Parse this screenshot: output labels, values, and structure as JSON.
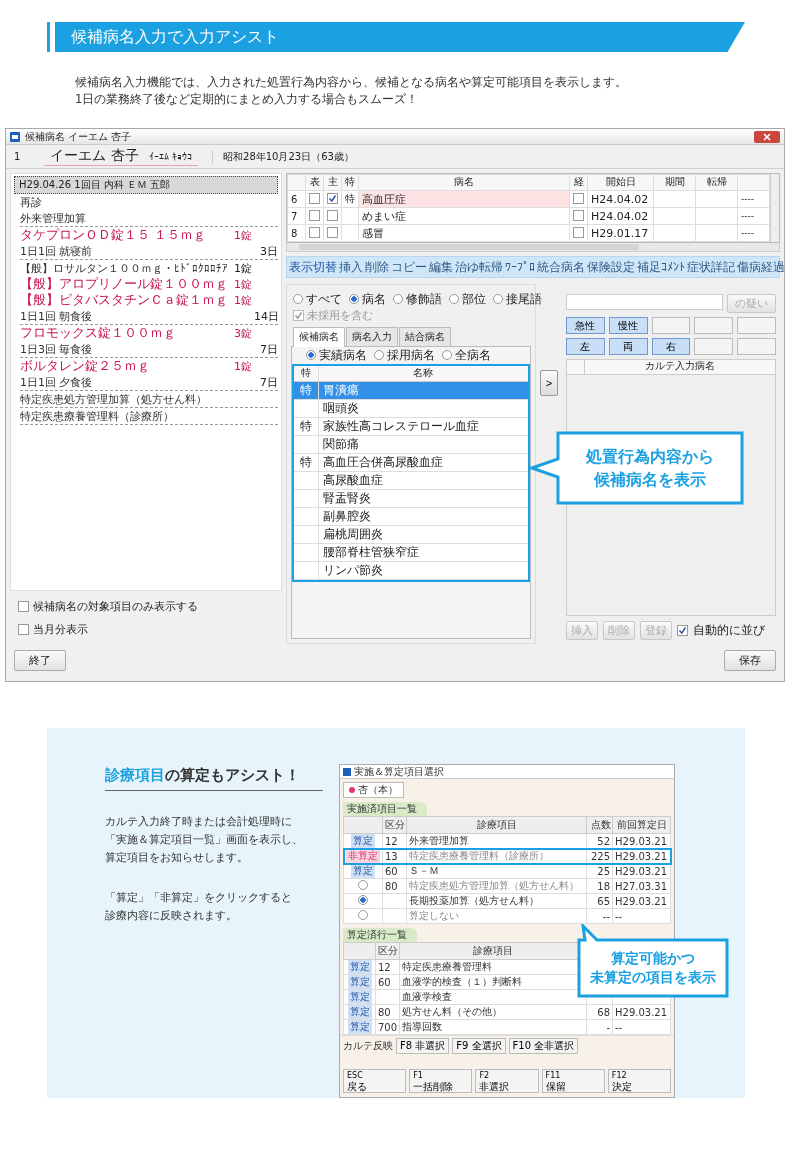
{
  "section_title": "候補病名入力で入力アシスト",
  "intro": [
    "候補病名入力機能では、入力された処置行為内容から、候補となる病名や算定可能項目を表示します。",
    "1日の業務終了後など定期的にまとめ入力する場合もスムーズ！"
  ],
  "app": {
    "title": "候補病名 イーエム 杏子",
    "patient": {
      "number": "1",
      "name": "イーエム 杏子",
      "kana": "ｲｰｴﾑ ｷｮｳｺ",
      "birth": "昭和28年10月23日（63歳）"
    },
    "visit": {
      "label": "H29.04.26 1回目 内科 ＥＭ 五郎",
      "selected": true
    },
    "order_groups": [
      {
        "items": [
          {
            "text": "再診",
            "highlighted": false
          },
          {
            "text": "外来管理加算",
            "highlighted": false
          }
        ]
      },
      {
        "items": [
          {
            "text": "タケプロンＯＤ錠１５ １５ｍｇ",
            "dose": "1錠",
            "highlighted": true
          },
          {
            "text": "1日1回 就寝前",
            "days": "3日",
            "highlighted": false
          }
        ]
      },
      {
        "items": [
          {
            "text": "【般】ロサルタン１００ｍｇ・ﾋﾄﾞﾛｸﾛﾛﾁｱ",
            "dose": "1錠",
            "highlighted": false
          },
          {
            "text": "【般】アロプリノール錠１００ｍｇ",
            "dose": "1錠",
            "highlighted": true
          },
          {
            "text": "【般】ピタバスタチンＣａ錠１ｍｇ",
            "dose": "1錠",
            "highlighted": true
          },
          {
            "text": "1日1回 朝食後",
            "days": "14日",
            "highlighted": false
          }
        ]
      },
      {
        "items": [
          {
            "text": "フロモックス錠１００ｍｇ",
            "dose": "3錠",
            "highlighted": true
          },
          {
            "text": "1日3回 毎食後",
            "days": "7日",
            "highlighted": false
          }
        ]
      },
      {
        "items": [
          {
            "text": "ボルタレン錠２５ｍｇ",
            "dose": "1錠",
            "highlighted": true
          },
          {
            "text": "1日1回 夕食後",
            "days": "7日",
            "highlighted": false
          }
        ]
      },
      {
        "items": [
          {
            "text": "特定疾患処方管理加算（処方せん料）",
            "highlighted": false
          }
        ]
      },
      {
        "items": [
          {
            "text": "特定疾患療養管理料（診療所）",
            "highlighted": false
          }
        ]
      }
    ],
    "disease_table": {
      "columns": [
        "表",
        "主",
        "特",
        "病名",
        "経",
        "開始日",
        "期間",
        "転帰"
      ],
      "rows": [
        {
          "no": "6",
          "hyo": false,
          "main": true,
          "toku": "特",
          "name": "高血圧症",
          "kei": false,
          "start": "H24.04.02",
          "column_10": "----",
          "selected": true
        },
        {
          "no": "7",
          "hyo": false,
          "main": false,
          "name": "めまい症",
          "kei": false,
          "start": "H24.04.02",
          "column_10": "----",
          "selected": false
        },
        {
          "no": "8",
          "hyo": false,
          "main": false,
          "name": "感冒",
          "kei": false,
          "start": "H29.01.17",
          "column_10": "----",
          "selected": false
        }
      ]
    },
    "toolbar": [
      "表示切替",
      "挿入",
      "削除",
      "コピー",
      "編集",
      "治ゆ転帰",
      "ﾜｰﾌﾟﾛ",
      "統合病名",
      "保険設定",
      "補足ｺﾒﾝﾄ",
      "症状詳記",
      "傷病経過"
    ],
    "filter": [
      {
        "label": "すべて",
        "selected": false
      },
      {
        "label": "病名",
        "selected": true
      },
      {
        "label": "修飾語",
        "selected": false
      },
      {
        "label": "部位",
        "selected": false
      },
      {
        "label": "接尾語",
        "selected": false
      }
    ],
    "include_unused": {
      "label": "未採用を含む",
      "checked": true,
      "disabled": true
    },
    "tabs": [
      {
        "label": "候補病名",
        "selected": true
      },
      {
        "label": "病名入力",
        "selected": false
      },
      {
        "label": "結合病名",
        "selected": false
      }
    ],
    "sources": [
      {
        "label": "実績病名",
        "selected": true
      },
      {
        "label": "採用病名",
        "selected": false
      },
      {
        "label": "全病名",
        "selected": false
      }
    ],
    "candidates": {
      "columns": [
        "特",
        "名称"
      ],
      "rows": [
        {
          "toku": "特",
          "name": "胃潰瘍",
          "selected": true
        },
        {
          "name": "咽頭炎",
          "selected": false
        },
        {
          "toku": "特",
          "name": "家族性高コレステロール血症",
          "selected": false
        },
        {
          "name": "関節痛",
          "selected": false
        },
        {
          "toku": "特",
          "name": "高血圧合併高尿酸血症",
          "selected": false
        },
        {
          "name": "高尿酸血症",
          "selected": false
        },
        {
          "name": "腎盂腎炎",
          "selected": false
        },
        {
          "name": "副鼻腔炎",
          "selected": false
        },
        {
          "name": "扁桃周囲炎",
          "selected": false
        },
        {
          "name": "腰部脊柱管狭窄症",
          "selected": false
        },
        {
          "name": "リンパ節炎",
          "selected": false
        }
      ]
    },
    "move_button": ">",
    "suspect_button": "の疑い",
    "modifiers": [
      [
        {
          "kind": "label",
          "label": "急性"
        },
        {
          "kind": "label",
          "label": "慢性"
        },
        {
          "kind": "empty"
        },
        {
          "kind": "empty"
        },
        {
          "kind": "empty"
        }
      ],
      [
        {
          "kind": "label",
          "label": "左"
        },
        {
          "kind": "label",
          "label": "両"
        },
        {
          "kind": "label",
          "label": "右"
        },
        {
          "kind": "empty"
        },
        {
          "kind": "empty"
        }
      ]
    ],
    "entered_table": {
      "columns": [
        "カルテ入力病名"
      ]
    },
    "entry_buttons": [
      {
        "label": "挿入",
        "disabled": true
      },
      {
        "label": "削除",
        "disabled": true
      },
      {
        "label": "登録",
        "disabled": true
      }
    ],
    "auto_sort": {
      "label": "自動的に並び",
      "checked": true
    },
    "options": [
      {
        "label": "候補病名の対象項目のみ表示する",
        "checked": false
      },
      {
        "label": "当月分表示",
        "checked": false
      }
    ],
    "close_button": "終了",
    "save_button": "保存",
    "callout": [
      "処置行為内容から",
      "候補病名を表示"
    ]
  },
  "feature": {
    "title": "**診療項目**の算定もアシスト！",
    "paragraphs": [
      [
        "カルテ入力終了時または会計処理時に",
        "「実施＆算定項目一覧」画面を表示し、",
        "算定項目をお知らせします。"
      ],
      [
        "「算定」「非算定」をクリックすると",
        "診療内容に反映されます。"
      ]
    ],
    "mini": {
      "title": "実施＆算定項目選択",
      "tab": "杏（本）",
      "upper": {
        "label": "実施済項目一覧",
        "columns": [
          "区分",
          "診療項目",
          "点数",
          "前回算定日"
        ],
        "rows": [
          {
            "kind": "calc",
            "action": "算定",
            "category": "12",
            "item": "外来管理加算",
            "points": "52",
            "last": "H29.03.21",
            "highlighted": false
          },
          {
            "kind": "noncalc",
            "action": "非算定",
            "category": "13",
            "item": "特定疾患療養管理料（診療所）",
            "points": "225",
            "last": "H29.03.21",
            "highlighted": true
          },
          {
            "kind": "calc",
            "action": "算定",
            "category": "60",
            "item": "Ｓ－Ｍ",
            "points": "25",
            "last": "H29.03.21",
            "highlighted": false
          },
          {
            "kind": "radio",
            "selected": false,
            "category": "80",
            "item": "特定疾患処方管理加算（処方せん料）",
            "points": "18",
            "last": "H27.03.31",
            "highlighted": false
          },
          {
            "kind": "radio",
            "selected": true,
            "item": "長期投薬加算（処方せん料）",
            "points": "65",
            "last": "H29.03.21",
            "highlighted": false
          },
          {
            "kind": "radio",
            "selected": false,
            "item": "算定しない",
            "points": "--",
            "last": "--",
            "highlighted": false
          }
        ]
      },
      "lower": {
        "label": "算定済行一覧",
        "columns": [
          "区分",
          "診療項目"
        ],
        "rows": [
          {
            "kind": "calc",
            "action": "算定",
            "category": "12",
            "item": "特定疾患療養管理料",
            "highlighted": false
          },
          {
            "kind": "calc",
            "action": "算定",
            "category": "60",
            "item": "血液学的検査（１）判断料",
            "highlighted": false
          },
          {
            "kind": "calc",
            "action": "算定",
            "item": "血液学検査",
            "highlighted": false
          },
          {
            "kind": "calc",
            "action": "算定",
            "category": "80",
            "item": "処方せん料（その他）",
            "points": "68",
            "last": "H29.03.21",
            "highlighted": false
          },
          {
            "kind": "calc",
            "action": "算定",
            "category": "700",
            "item": "指導回数",
            "points": "-",
            "last": "--",
            "highlighted": false
          }
        ]
      },
      "reflect_label": "カルテ反映",
      "select_buttons": [
        "F8 非選択",
        "F9 全選択",
        "F10 全非選択"
      ],
      "footer_buttons": [
        {
          "key": "ESC",
          "label": "戻る"
        },
        {
          "key": "F1",
          "label": "一括削除"
        },
        {
          "key": "F2",
          "label": "非選択"
        },
        {
          "key": "F11",
          "label": "保留"
        },
        {
          "key": "F12",
          "label": "決定"
        }
      ]
    },
    "callout": [
      "算定可能かつ",
      "未算定の項目を表示"
    ]
  }
}
